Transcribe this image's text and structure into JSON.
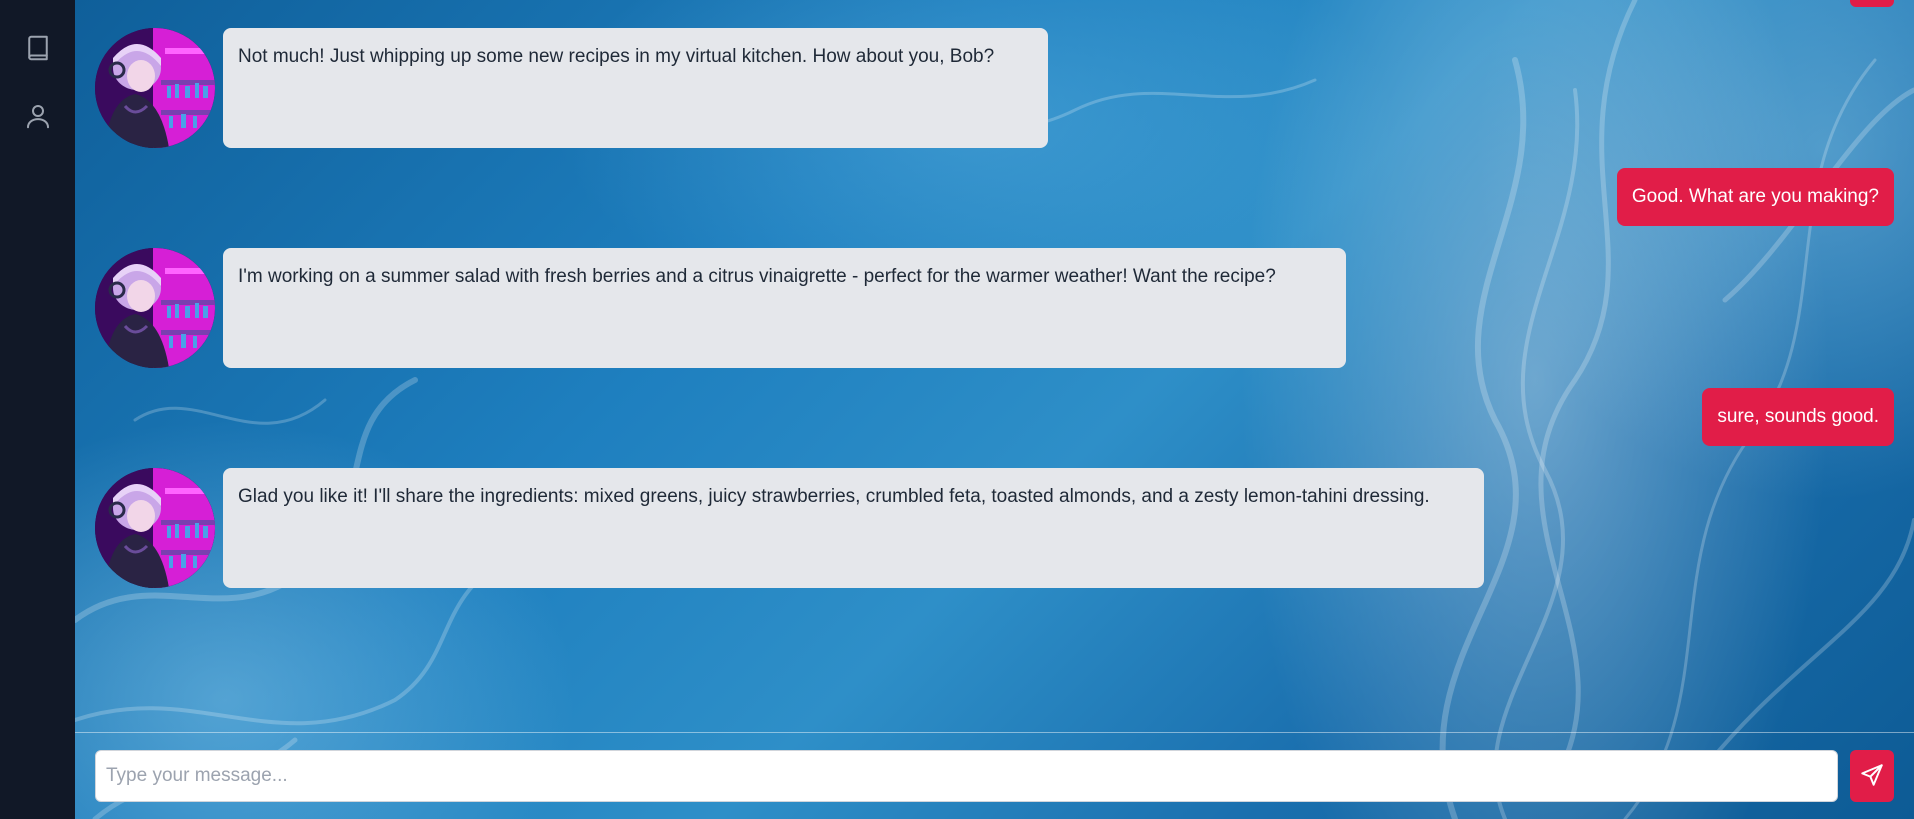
{
  "sidebar": {
    "items": [
      {
        "name": "book-icon"
      },
      {
        "name": "user-icon"
      }
    ]
  },
  "messages": [
    {
      "sender": "bot",
      "text": "Not much! Just whipping up some new recipes in my virtual kitchen. How about you, Bob?"
    },
    {
      "sender": "user",
      "text": "Good. What are you making?"
    },
    {
      "sender": "bot",
      "text": "I'm working on a summer salad with fresh berries and a citrus vinaigrette - perfect for the warmer weather! Want the recipe?"
    },
    {
      "sender": "user",
      "text": "sure, sounds good."
    },
    {
      "sender": "bot",
      "text": "Glad you like it! I'll share the ingredients: mixed greens, juicy strawberries, crumbled feta, toasted almonds, and a zesty lemon-tahini dressing."
    }
  ],
  "composer": {
    "placeholder": "Type your message...",
    "value": "",
    "send_icon": "send-icon"
  },
  "colors": {
    "sidebar_bg": "#111827",
    "accent": "#e11d48",
    "bot_bubble": "#e5e7eb",
    "bot_text": "#1f2937",
    "user_text": "#ffffff"
  }
}
